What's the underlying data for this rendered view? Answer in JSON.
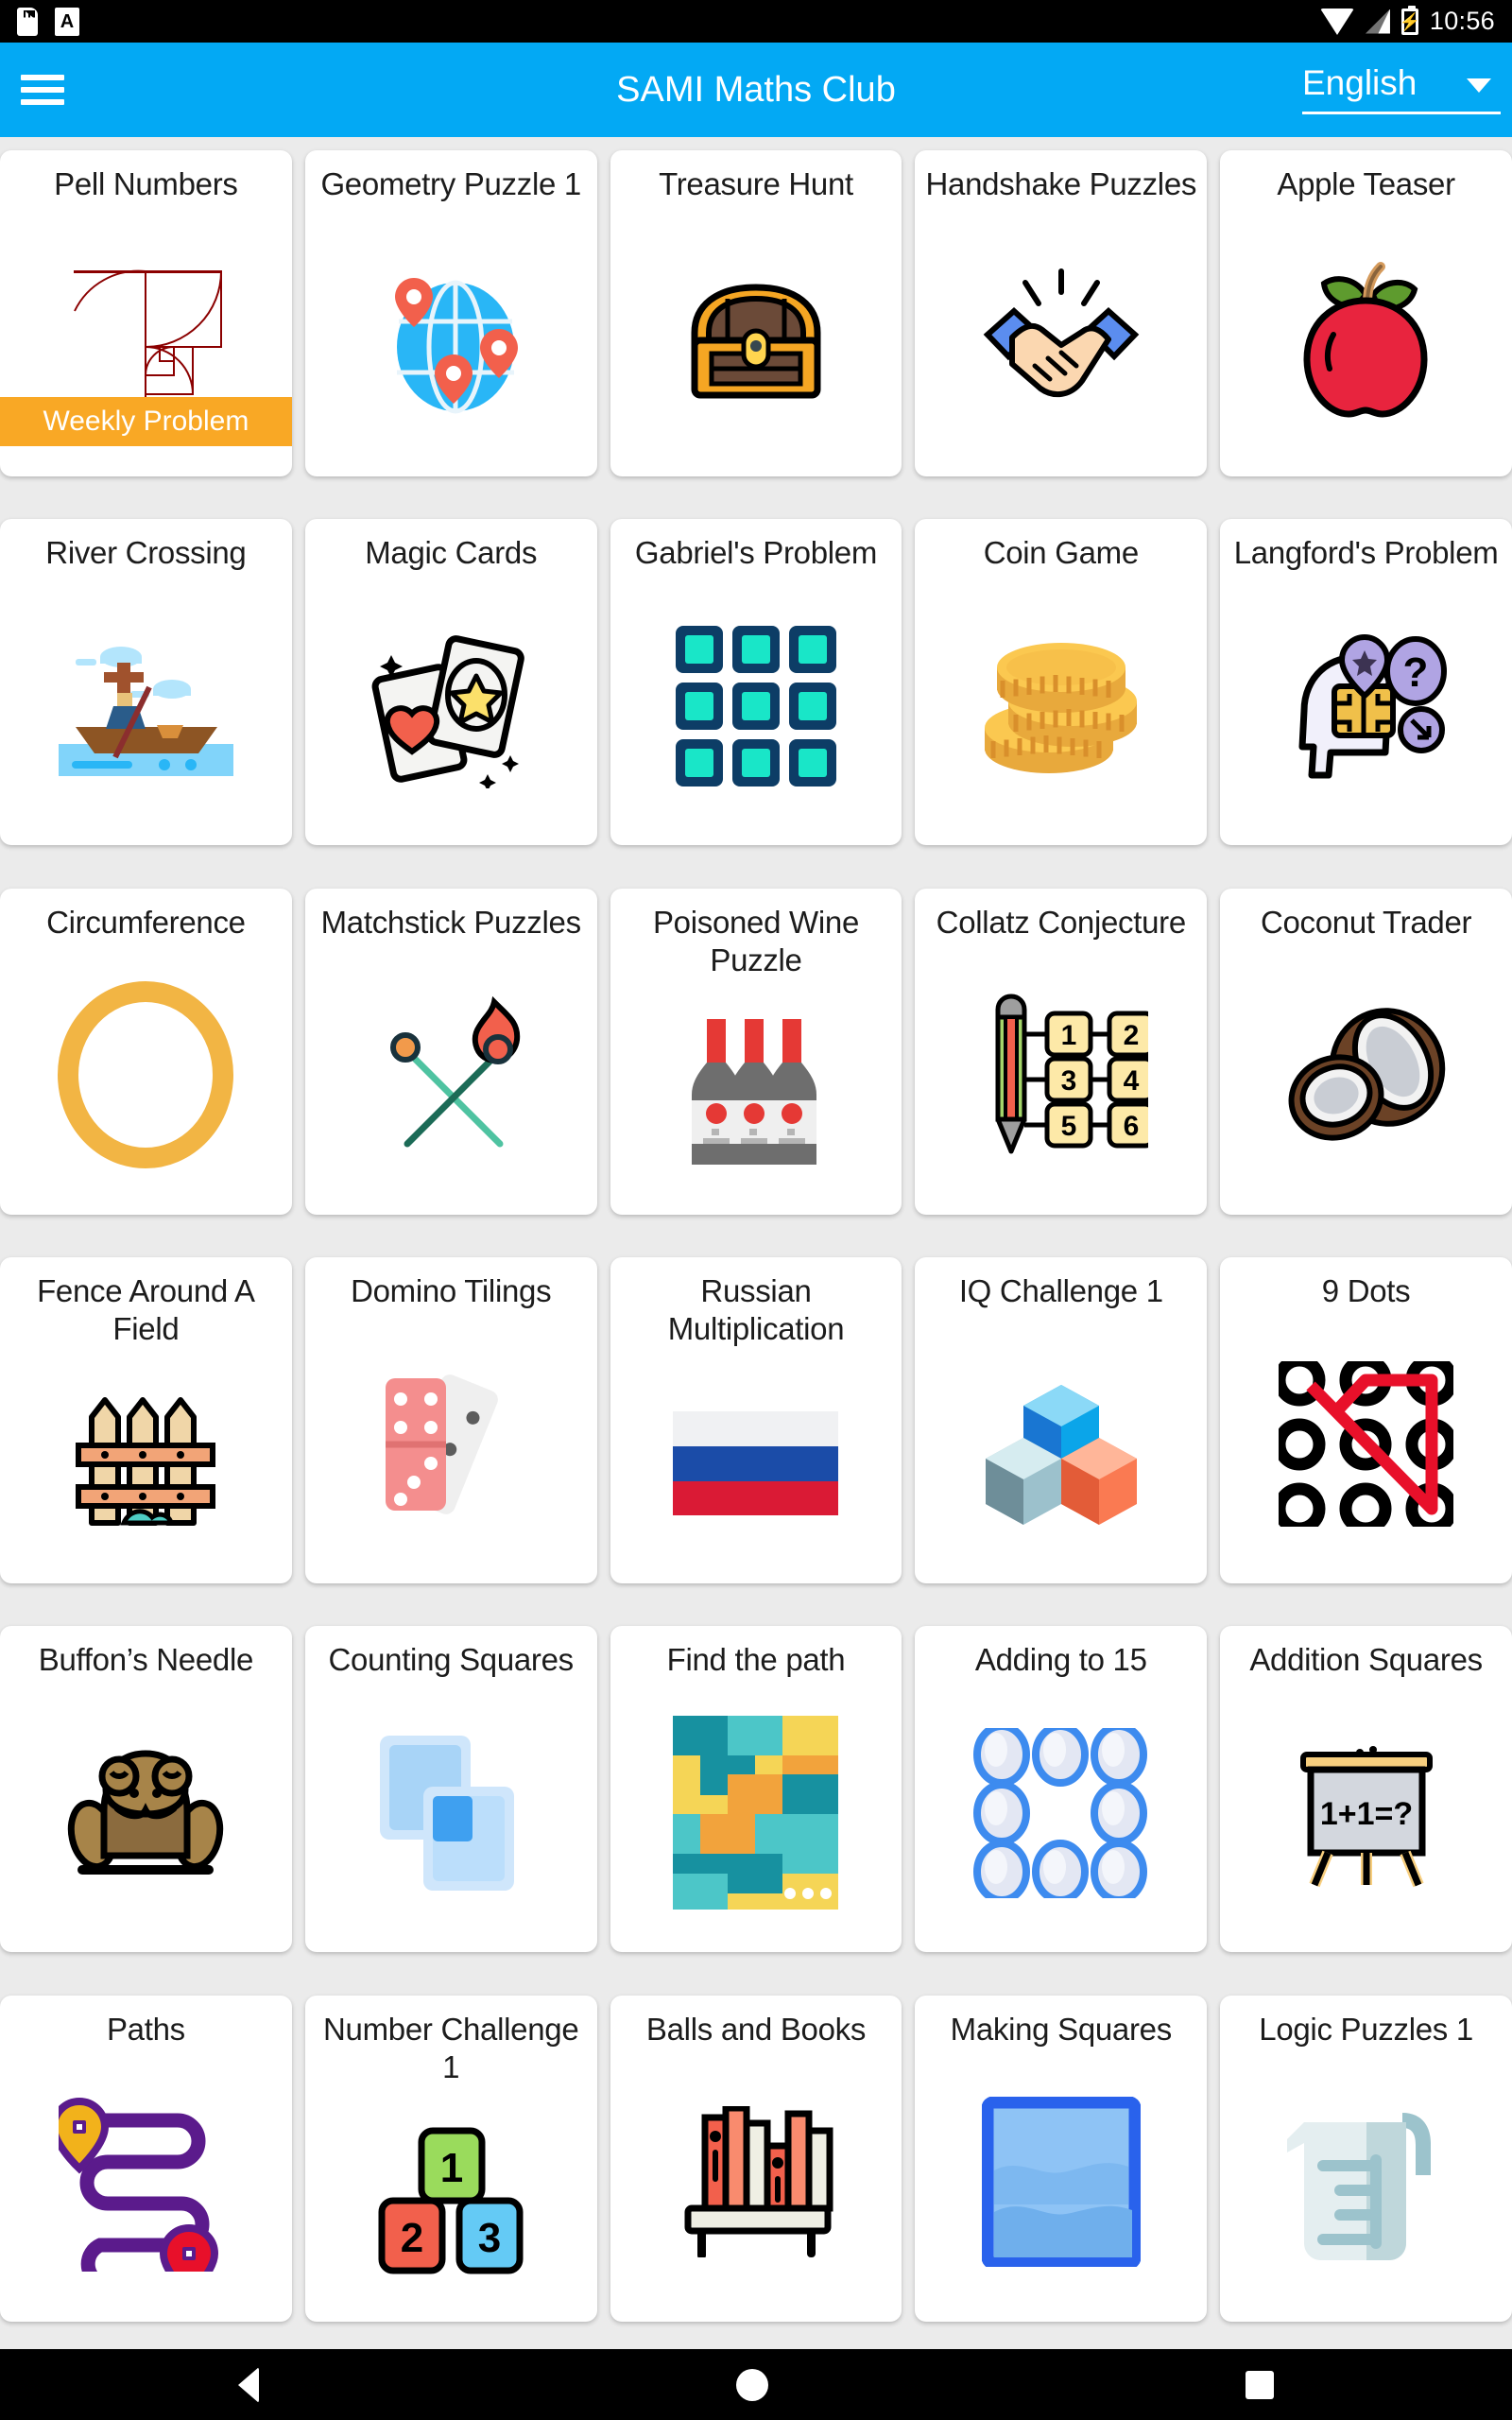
{
  "statusbar": {
    "sd_icon": "sd-card-icon",
    "font_icon": "font-size-icon",
    "font_glyph": "A",
    "wifi_icon": "wifi-icon",
    "signal_icon": "cellular-signal-icon",
    "battery_icon": "battery-charging-icon",
    "battery_glyph": "⚡",
    "time": "10:56"
  },
  "appbar": {
    "menu_icon": "hamburger-menu-icon",
    "title": "SAMI Maths Club",
    "language": "English",
    "caret_icon": "chevron-down-icon",
    "accent_color": "#03A9F4"
  },
  "badge": {
    "label": "Weekly Problem",
    "color": "#F9A825"
  },
  "navbar": {
    "back_icon": "back-triangle-icon",
    "home_icon": "home-circle-icon",
    "recents_icon": "recents-square-icon"
  },
  "cards": [
    {
      "title": "Pell Numbers",
      "art": "golden-spiral-art",
      "badge": true
    },
    {
      "title": "Geometry Puzzle 1",
      "art": "globe-pins-art",
      "badge": false
    },
    {
      "title": "Treasure Hunt",
      "art": "treasure-chest-art",
      "badge": false
    },
    {
      "title": "Handshake Puzzles",
      "art": "handshake-art",
      "badge": false
    },
    {
      "title": "Apple Teaser",
      "art": "apple-art",
      "badge": false
    },
    {
      "title": "River Crossing",
      "art": "boat-river-art",
      "badge": false
    },
    {
      "title": "Magic Cards",
      "art": "magic-cards-art",
      "badge": false
    },
    {
      "title": "Gabriel's Problem",
      "art": "nine-grid-art",
      "badge": false
    },
    {
      "title": "Coin Game",
      "art": "coin-stack-art",
      "badge": false
    },
    {
      "title": "Langford's Problem",
      "art": "brain-question-art",
      "badge": false
    },
    {
      "title": "Circumference",
      "art": "circle-ring-art",
      "badge": false
    },
    {
      "title": "Matchstick Puzzles",
      "art": "matchsticks-art",
      "badge": false
    },
    {
      "title": "Poisoned Wine Puzzle",
      "art": "wine-bottles-art",
      "badge": false
    },
    {
      "title": "Collatz Conjecture",
      "art": "pencil-numbers-art",
      "badge": false
    },
    {
      "title": "Coconut Trader",
      "art": "coconut-art",
      "badge": false
    },
    {
      "title": "Fence Around A Field",
      "art": "fence-art",
      "badge": false
    },
    {
      "title": "Domino Tilings",
      "art": "dominoes-art",
      "badge": false
    },
    {
      "title": "Russian Multiplication",
      "art": "russian-flag-art",
      "badge": false
    },
    {
      "title": "IQ Challenge 1",
      "art": "cubes-art",
      "badge": false
    },
    {
      "title": "9 Dots",
      "art": "nine-dots-art",
      "badge": false
    },
    {
      "title": "Buffon’s Needle",
      "art": "frog-art",
      "badge": false
    },
    {
      "title": "Counting Squares",
      "art": "overlapping-squares-art",
      "badge": false
    },
    {
      "title": "Find the path",
      "art": "mosaic-path-art",
      "badge": false
    },
    {
      "title": "Adding to 15",
      "art": "eight-circles-art",
      "badge": false
    },
    {
      "title": "Addition Squares",
      "art": "easel-art",
      "badge": false
    },
    {
      "title": "Paths",
      "art": "winding-path-art",
      "badge": false
    },
    {
      "title": "Number Challenge 1",
      "art": "number-blocks-art",
      "badge": false
    },
    {
      "title": "Balls and Books",
      "art": "bookshelf-art",
      "badge": false
    },
    {
      "title": "Making Squares",
      "art": "blue-square-art",
      "badge": false
    },
    {
      "title": "Logic Puzzles 1",
      "art": "measuring-jug-art",
      "badge": false
    }
  ],
  "number_blocks": {
    "top": "1",
    "left": "2",
    "right": "3"
  },
  "collatz_numbers": [
    "1",
    "2",
    "3",
    "4",
    "5",
    "6"
  ],
  "easel_text": "1+1=?"
}
